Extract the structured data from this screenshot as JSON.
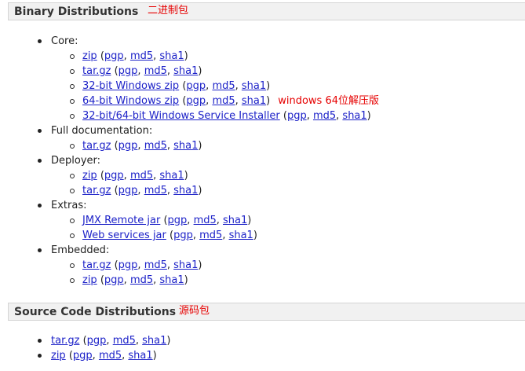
{
  "sections": [
    {
      "title": "Binary Distributions",
      "note": "二进制包"
    },
    {
      "title": "Source Code Distributions",
      "note": "源码包"
    }
  ],
  "annotation_64bit": "windows 64位解压版",
  "sig": {
    "pgp": "pgp",
    "md5": "md5",
    "sha1": "sha1"
  },
  "binary": {
    "core": {
      "label": "Core:",
      "items": [
        "zip",
        "tar.gz",
        "32-bit Windows zip",
        "64-bit Windows zip",
        "32-bit/64-bit Windows Service Installer"
      ]
    },
    "fulldoc": {
      "label": "Full documentation:",
      "items": [
        "tar.gz"
      ]
    },
    "deployer": {
      "label": "Deployer:",
      "items": [
        "zip",
        "tar.gz"
      ]
    },
    "extras": {
      "label": "Extras:",
      "items": [
        "JMX Remote jar",
        "Web services jar"
      ]
    },
    "embedded": {
      "label": "Embedded:",
      "items": [
        "tar.gz",
        "zip"
      ]
    }
  },
  "source": {
    "items": [
      "tar.gz",
      "zip"
    ]
  },
  "colors": {
    "link": "#1d22c8",
    "annotation": "#e60000",
    "header_bg": "#f1f1f1"
  }
}
